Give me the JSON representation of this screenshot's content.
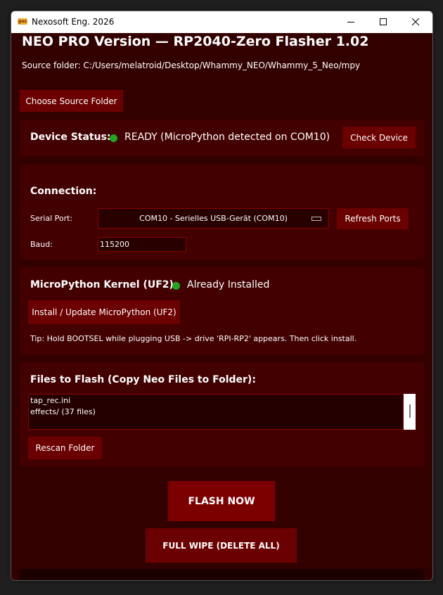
{
  "window": {
    "title": "Nexosoft Eng. 2026",
    "icon_text": "ges"
  },
  "header": {
    "title": "NEO PRO Version — RP2040-Zero Flasher 1.02",
    "source_folder": "Source folder: C:/Users/melatroid/Desktop/Whammy_NEO/Whammy_5_Neo/mpy",
    "choose_folder_label": "Choose Source Folder"
  },
  "device_status": {
    "label": "Device Status:",
    "status_text": "READY (MicroPython detected on COM10)",
    "status_color": "#1fa81f",
    "check_label": "Check Device"
  },
  "connection": {
    "title": "Connection:",
    "serial_port_label": "Serial Port:",
    "serial_port_value": "COM10 - Serielles USB-Gerät (COM10)",
    "refresh_label": "Refresh Ports",
    "baud_label": "Baud:",
    "baud_value": "115200"
  },
  "kernel": {
    "title": "MicroPython Kernel (UF2):",
    "status_text": "Already Installed",
    "status_color": "#1fa81f",
    "install_label": "Install / Update MicroPython (UF2)",
    "tip": "Tip: Hold BOOTSEL while plugging USB -> drive 'RPI-RP2' appears. Then click install."
  },
  "files": {
    "title": "Files to Flash (Copy Neo Files to Folder):",
    "items": [
      "tap_rec.ini",
      "effects/ (37 files)"
    ],
    "rescan_label": "Rescan Folder"
  },
  "actions": {
    "flash_label": "FLASH NOW",
    "wipe_label": "FULL WIPE (DELETE ALL)"
  },
  "progress": {
    "value": 0
  },
  "colors": {
    "background": "#330000",
    "panel": "#420000",
    "button": "#6b0000",
    "accent_border": "#8a0000"
  }
}
